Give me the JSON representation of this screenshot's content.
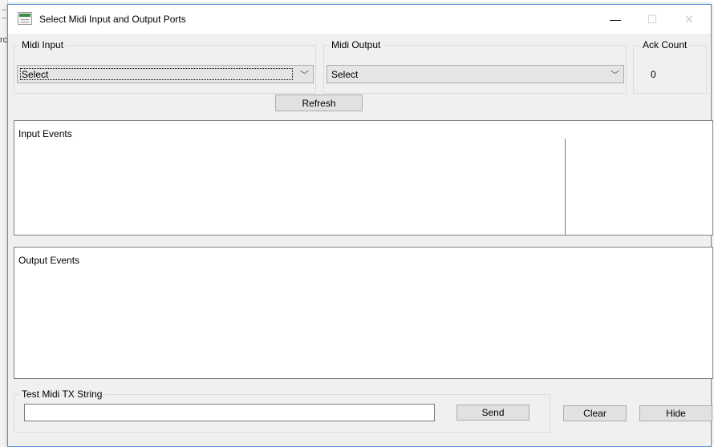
{
  "window": {
    "title": "Select Midi Input and Output Ports",
    "minimize_glyph": "—",
    "maximize_glyph": "☐",
    "close_glyph": "✕"
  },
  "background": {
    "sliver_text": "rc"
  },
  "midi_input": {
    "label": "Midi Input",
    "selected": "Select"
  },
  "midi_output": {
    "label": "Midi Output",
    "selected": "Select"
  },
  "ack_count": {
    "label": "Ack Count",
    "value": "0"
  },
  "buttons": {
    "refresh": "Refresh",
    "send": "Send",
    "clear": "Clear",
    "hide": "Hide"
  },
  "panels": {
    "input_events": "Input Events",
    "output_events": "Output Events"
  },
  "test_tx": {
    "label": "Test Midi TX String",
    "value": ""
  },
  "icons": {
    "app": "app-window-icon",
    "dropdown": "chevron-down-icon"
  }
}
